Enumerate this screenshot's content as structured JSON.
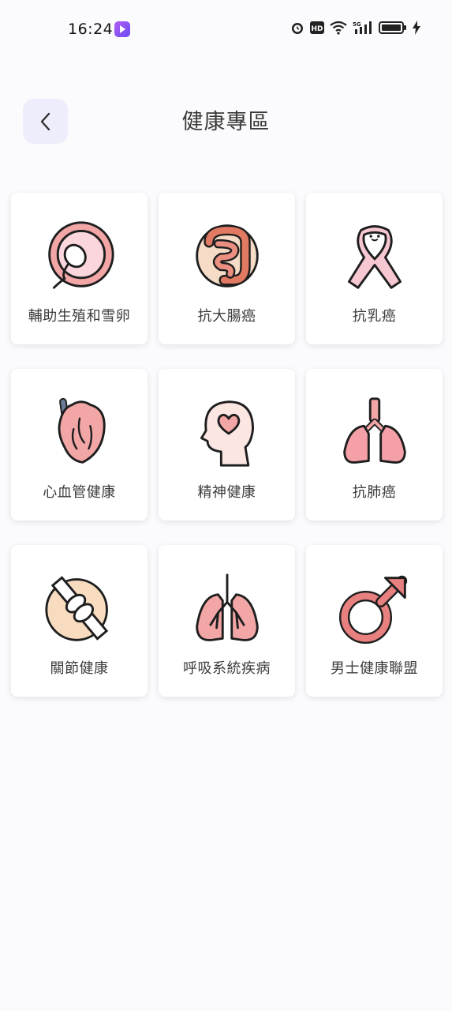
{
  "status": {
    "time": "16:24",
    "icons": [
      "alarm-icon",
      "hd-icon",
      "wifi-icon",
      "signal-5g-icon",
      "battery-icon",
      "charging-icon"
    ]
  },
  "header": {
    "title": "健康專區",
    "back_icon": "chevron-left-icon"
  },
  "categories": [
    {
      "label": "輔助生殖和雪卵",
      "icon": "fertility-icon"
    },
    {
      "label": "抗大腸癌",
      "icon": "intestine-icon"
    },
    {
      "label": "抗乳癌",
      "icon": "pink-ribbon-icon"
    },
    {
      "label": "心血管健康",
      "icon": "heart-organ-icon"
    },
    {
      "label": "精神健康",
      "icon": "mental-health-icon"
    },
    {
      "label": "抗肺癌",
      "icon": "lung-icon"
    },
    {
      "label": "關節健康",
      "icon": "joint-bone-icon"
    },
    {
      "label": "呼吸系統疾病",
      "icon": "respiratory-lungs-icon"
    },
    {
      "label": "男士健康聯盟",
      "icon": "male-symbol-icon"
    }
  ],
  "colors": {
    "pink_main": "#f2a6a6",
    "pink_dark": "#e07a7a",
    "outline": "#1e1e1e",
    "back_bg": "#eeedfb"
  }
}
